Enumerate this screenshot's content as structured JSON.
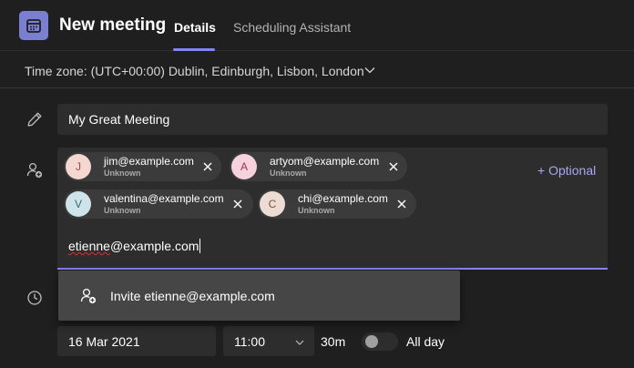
{
  "header": {
    "title": "New meeting",
    "tabs": [
      {
        "label": "Details",
        "active": true
      },
      {
        "label": "Scheduling Assistant",
        "active": false
      }
    ]
  },
  "timezone": {
    "label": "Time zone: (UTC+00:00) Dublin, Edinburgh, Lisbon, London"
  },
  "meeting": {
    "title_value": "My Great Meeting"
  },
  "attendees": {
    "chips": [
      {
        "initial": "J",
        "email": "jim@example.com",
        "status": "Unknown",
        "avatar_bg": "#f4d7d0",
        "avatar_fg": "#a3473a"
      },
      {
        "initial": "A",
        "email": "artyom@example.com",
        "status": "Unknown",
        "avatar_bg": "#f6d3dc",
        "avatar_fg": "#a8344f"
      },
      {
        "initial": "V",
        "email": "valentina@example.com",
        "status": "Unknown",
        "avatar_bg": "#cfe3ea",
        "avatar_fg": "#3b6877"
      },
      {
        "initial": "C",
        "email": "chi@example.com",
        "status": "Unknown",
        "avatar_bg": "#ecdcd3",
        "avatar_fg": "#7a5340"
      }
    ],
    "optional_label": "+ Optional",
    "typed_value": "etienne@example.com",
    "typed_misspelled_part": "etienne"
  },
  "suggestion": {
    "label": "Invite etienne@example.com"
  },
  "datetime": {
    "date": "16 Mar 2021",
    "time": "11:00",
    "duration": "30m",
    "all_day_label": "All day",
    "all_day_on": false
  },
  "colors": {
    "accent": "#7f85f5",
    "background": "#1f1f1f",
    "field": "#2d2d2d"
  }
}
